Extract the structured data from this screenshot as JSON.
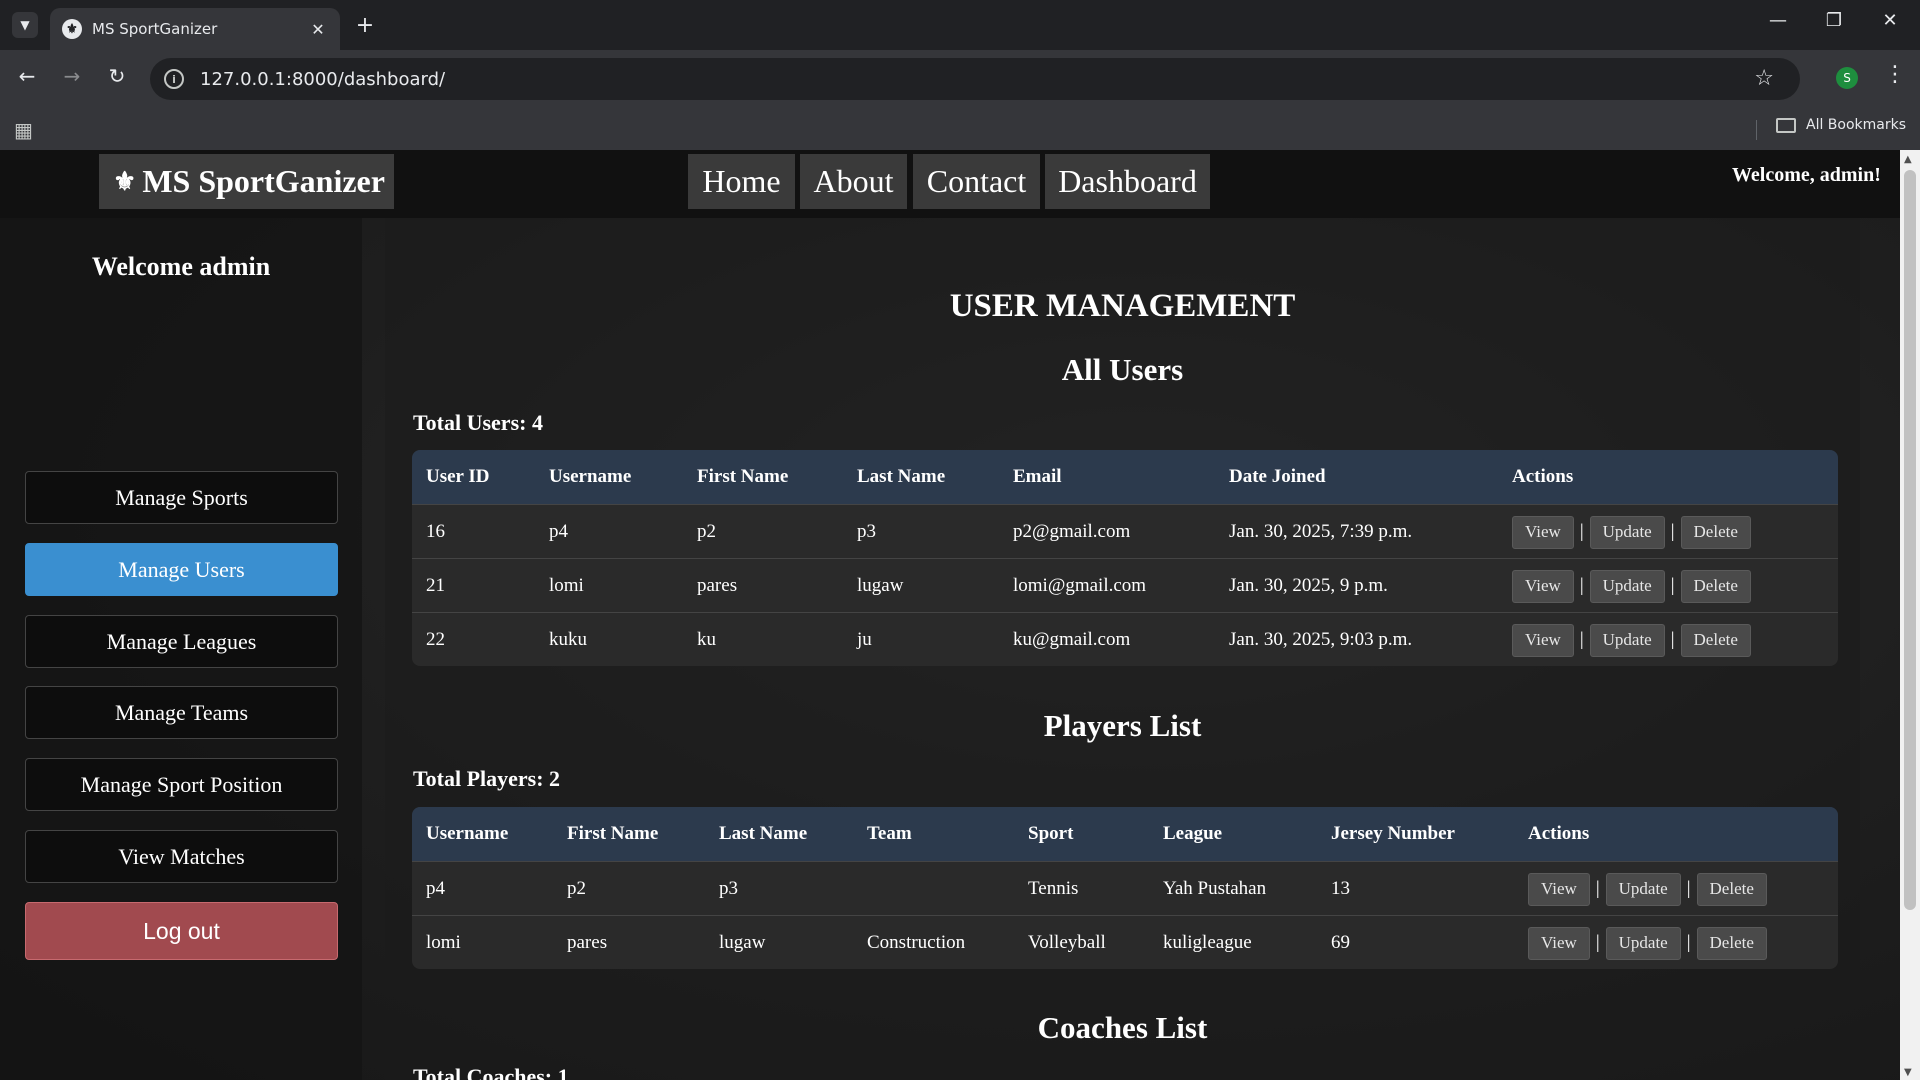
{
  "browser": {
    "tab_title": "MS SportGanizer",
    "new_tab": "+",
    "url": "127.0.0.1:8000/dashboard/",
    "profile_initial": "S",
    "bookmarks_label": "All Bookmarks"
  },
  "site": {
    "brand": "MS SportGanizer",
    "nav": [
      "Home",
      "About",
      "Contact",
      "Dashboard"
    ],
    "welcome": "Welcome, admin!"
  },
  "sidebar": {
    "title": "Welcome admin",
    "items": [
      "Manage Sports",
      "Manage Users",
      "Manage Leagues",
      "Manage Teams",
      "Manage Sport Position",
      "View Matches"
    ],
    "active": "Manage Users",
    "logout": "Log out"
  },
  "main": {
    "heading": "USER MANAGEMENT",
    "users": {
      "title": "All Users",
      "total": "Total Users: 4",
      "columns": [
        "User ID",
        "Username",
        "First Name",
        "Last Name",
        "Email",
        "Date Joined",
        "Actions"
      ],
      "rows": [
        [
          "16",
          "p4",
          "p2",
          "p3",
          "p2@gmail.com",
          "Jan. 30, 2025, 7:39 p.m."
        ],
        [
          "21",
          "lomi",
          "pares",
          "lugaw",
          "lomi@gmail.com",
          "Jan. 30, 2025, 9 p.m."
        ],
        [
          "22",
          "kuku",
          "ku",
          "ju",
          "ku@gmail.com",
          "Jan. 30, 2025, 9:03 p.m."
        ]
      ]
    },
    "players": {
      "title": "Players List",
      "total": "Total Players: 2",
      "columns": [
        "Username",
        "First Name",
        "Last Name",
        "Team",
        "Sport",
        "League",
        "Jersey Number",
        "Actions"
      ],
      "rows": [
        [
          "p4",
          "p2",
          "p3",
          "",
          "Tennis",
          "Yah Pustahan",
          "13"
        ],
        [
          "lomi",
          "pares",
          "lugaw",
          "Construction",
          "Volleyball",
          "kuligleague",
          "69"
        ]
      ]
    },
    "coaches": {
      "title": "Coaches List",
      "total": "Total Coaches: 1"
    },
    "actions": {
      "view": "View",
      "update": "Update",
      "delete": "Delete",
      "separator": "|"
    }
  }
}
